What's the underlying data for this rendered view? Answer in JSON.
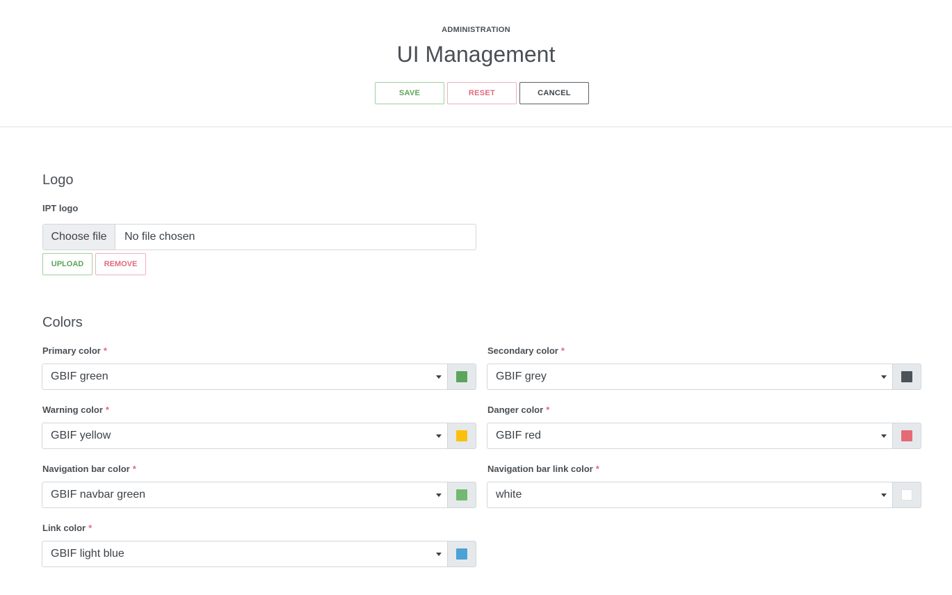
{
  "header": {
    "eyebrow": "ADMINISTRATION",
    "title": "UI Management",
    "save_label": "SAVE",
    "reset_label": "RESET",
    "cancel_label": "CANCEL"
  },
  "logo": {
    "section_title": "Logo",
    "field_label": "IPT logo",
    "choose_label": "Choose file",
    "no_file_text": "No file chosen",
    "upload_label": "UPLOAD",
    "remove_label": "REMOVE"
  },
  "colors": {
    "section_title": "Colors",
    "required_mark": "*",
    "fields": [
      {
        "label": "Primary color",
        "value": "GBIF green",
        "swatch": "#5ba55d"
      },
      {
        "label": "Secondary color",
        "value": "GBIF grey",
        "swatch": "#4c5359"
      },
      {
        "label": "Warning color",
        "value": "GBIF yellow",
        "swatch": "#fbc00e"
      },
      {
        "label": "Danger color",
        "value": "GBIF red",
        "swatch": "#e26b76"
      },
      {
        "label": "Navigation bar color",
        "value": "GBIF navbar green",
        "swatch": "#72b972"
      },
      {
        "label": "Navigation bar link color",
        "value": "white",
        "swatch": "#ffffff"
      },
      {
        "label": "Link color",
        "value": "GBIF light blue",
        "swatch": "#4ba2d7"
      }
    ]
  }
}
